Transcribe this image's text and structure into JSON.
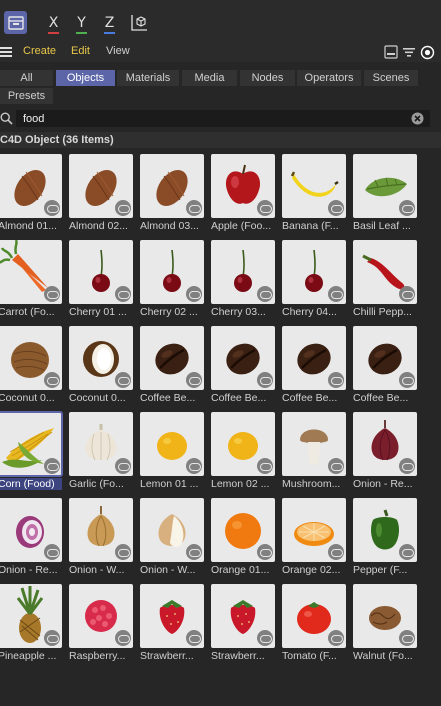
{
  "toolbar": {
    "axes": [
      {
        "label": "X",
        "color": "#d04040"
      },
      {
        "label": "Y",
        "color": "#50b050"
      },
      {
        "label": "Z",
        "color": "#4a7be0"
      }
    ]
  },
  "menu": {
    "items": [
      "Create",
      "Edit",
      "View"
    ]
  },
  "tabs": {
    "items": [
      "All",
      "Objects",
      "Materials",
      "Media",
      "Nodes",
      "Operators",
      "Scenes",
      "Presets"
    ],
    "selected": "Objects"
  },
  "search": {
    "value": "food"
  },
  "section": {
    "title": "C4D Object (36 Items)"
  },
  "items": [
    {
      "label": "Almond 01...",
      "icon": "almond-icon"
    },
    {
      "label": "Almond 02...",
      "icon": "almond-icon"
    },
    {
      "label": "Almond 03...",
      "icon": "almond-icon"
    },
    {
      "label": "Apple (Foo...",
      "icon": "apple-icon"
    },
    {
      "label": "Banana (F...",
      "icon": "banana-icon"
    },
    {
      "label": "Basil Leaf ...",
      "icon": "basil-leaf-icon"
    },
    {
      "label": "Carrot (Fo...",
      "icon": "carrot-icon"
    },
    {
      "label": "Cherry 01 ...",
      "icon": "cherry-icon"
    },
    {
      "label": "Cherry 02 ...",
      "icon": "cherry-icon"
    },
    {
      "label": "Cherry 03...",
      "icon": "cherry-icon"
    },
    {
      "label": "Cherry 04...",
      "icon": "cherry-icon"
    },
    {
      "label": "Chilli Pepp...",
      "icon": "chilli-pepper-icon"
    },
    {
      "label": "Coconut 0...",
      "icon": "coconut-icon"
    },
    {
      "label": "Coconut 0...",
      "icon": "coconut-half-icon"
    },
    {
      "label": "Coffee Be...",
      "icon": "coffee-bean-icon"
    },
    {
      "label": "Coffee Be...",
      "icon": "coffee-bean-icon"
    },
    {
      "label": "Coffee Be...",
      "icon": "coffee-bean-icon"
    },
    {
      "label": "Coffee Be...",
      "icon": "coffee-bean-icon"
    },
    {
      "label": "Corn (Food)",
      "icon": "corn-icon"
    },
    {
      "label": "Garlic (Fo...",
      "icon": "garlic-icon"
    },
    {
      "label": "Lemon 01 ...",
      "icon": "lemon-icon"
    },
    {
      "label": "Lemon 02 ...",
      "icon": "lemon-icon"
    },
    {
      "label": "Mushroom...",
      "icon": "mushroom-icon"
    },
    {
      "label": "Onion - Re...",
      "icon": "red-onion-icon"
    },
    {
      "label": "Onion - Re...",
      "icon": "red-onion-half-icon"
    },
    {
      "label": "Onion - W...",
      "icon": "white-onion-icon"
    },
    {
      "label": "Onion - W...",
      "icon": "white-onion-half-icon"
    },
    {
      "label": "Orange 01...",
      "icon": "orange-icon"
    },
    {
      "label": "Orange 02...",
      "icon": "orange-half-icon"
    },
    {
      "label": "Pepper (F...",
      "icon": "pepper-icon"
    },
    {
      "label": "Pineapple ...",
      "icon": "pineapple-icon"
    },
    {
      "label": "Raspberry...",
      "icon": "raspberry-icon"
    },
    {
      "label": "Strawberr...",
      "icon": "strawberry-icon"
    },
    {
      "label": "Strawberr...",
      "icon": "strawberry-icon"
    },
    {
      "label": "Tomato (F...",
      "icon": "tomato-icon"
    },
    {
      "label": "Walnut (Fo...",
      "icon": "walnut-icon"
    }
  ]
}
